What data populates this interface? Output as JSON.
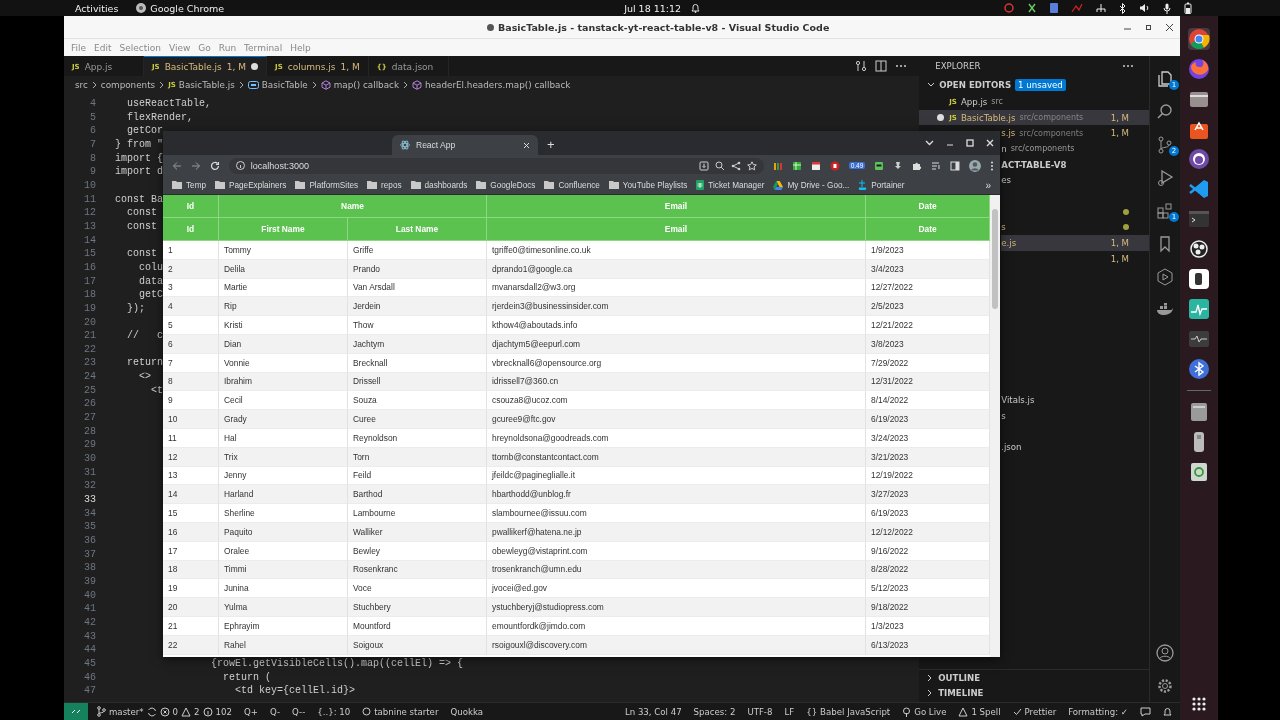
{
  "top_bar": {
    "activities": "Activities",
    "app": "Google Chrome",
    "clock": "Jul 18  11:12"
  },
  "vscode": {
    "title": "BasicTable.js - tanstack-yt-react-table-v8 - Visual Studio Code",
    "title_unsaved": true,
    "menu": [
      "File",
      "Edit",
      "Selection",
      "View",
      "Go",
      "Run",
      "Terminal",
      "Help"
    ],
    "tabs": [
      {
        "icon": "JS",
        "label": "App.js",
        "selected": false,
        "git_modified": false,
        "unsaved": false
      },
      {
        "icon": "JS",
        "label": "BasicTable.js",
        "status": "1, M",
        "selected": true,
        "git_modified": true,
        "unsaved": true
      },
      {
        "icon": "JS",
        "label": "columns.js",
        "status": "1, M",
        "selected": false,
        "git_modified": true,
        "unsaved": false
      },
      {
        "icon": "{}",
        "label": "data.json",
        "selected": false,
        "git_modified": false,
        "unsaved": false
      }
    ],
    "breadcrumbs": [
      {
        "kind": "folder",
        "label": "src"
      },
      {
        "kind": "folder",
        "label": "components"
      },
      {
        "kind": "file",
        "icon": "JS",
        "label": "BasicTable.js"
      },
      {
        "kind": "variable",
        "label": "BasicTable"
      },
      {
        "kind": "method",
        "label": "map() callback"
      },
      {
        "kind": "method",
        "label": "headerEl.headers.map() callback"
      }
    ],
    "code_lines": [
      {
        "number": "4",
        "text": "  useReactTable,",
        "current": false
      },
      {
        "number": "5",
        "text": "  flexRender,",
        "current": false
      },
      {
        "number": "6",
        "text": "  getCor",
        "current": false
      },
      {
        "number": "7",
        "text": "} from \"",
        "current": false
      },
      {
        "number": "8",
        "text": "import {",
        "current": false
      },
      {
        "number": "9",
        "text": "import d",
        "current": false
      },
      {
        "number": "10",
        "current": false
      },
      {
        "number": "11",
        "text": "const Ba",
        "current": false
      },
      {
        "number": "12",
        "text": "  const",
        "current": false
      },
      {
        "number": "13",
        "text": "  const",
        "current": false
      },
      {
        "number": "14",
        "current": false
      },
      {
        "number": "15",
        "text": "  const",
        "current": false
      },
      {
        "number": "16",
        "text": "    colu",
        "current": false
      },
      {
        "number": "17",
        "text": "    data",
        "current": false
      },
      {
        "number": "18",
        "text": "    getC",
        "current": false
      },
      {
        "number": "19",
        "text": "  });",
        "current": false
      },
      {
        "number": "20",
        "current": false
      },
      {
        "number": "21",
        "text": "  //   c",
        "current": false
      },
      {
        "number": "22",
        "current": false
      },
      {
        "number": "23",
        "text": "  return",
        "current": false
      },
      {
        "number": "24",
        "text": "    <>",
        "current": false
      },
      {
        "number": "25",
        "text": "      <t",
        "current": false
      },
      {
        "number": "26",
        "current": false
      },
      {
        "number": "27",
        "current": false
      },
      {
        "number": "28",
        "current": false
      },
      {
        "number": "29",
        "current": false
      },
      {
        "number": "30",
        "current": false
      },
      {
        "number": "31",
        "current": false
      },
      {
        "number": "32",
        "current": false
      },
      {
        "number": "33",
        "current": true
      },
      {
        "number": "34",
        "current": false
      },
      {
        "number": "35",
        "current": false
      },
      {
        "number": "36",
        "current": false
      },
      {
        "number": "37",
        "current": false
      },
      {
        "number": "38",
        "current": false
      },
      {
        "number": "39",
        "current": false
      },
      {
        "number": "40",
        "current": false
      },
      {
        "number": "41",
        "current": false
      },
      {
        "number": "42",
        "current": false
      },
      {
        "number": "43",
        "current": false
      },
      {
        "number": "44",
        "current": false
      },
      {
        "number": "45",
        "text": "                {rowEl.getVisibleCells().map((cellEl) => {",
        "current": false
      },
      {
        "number": "46",
        "text": "                  return (",
        "current": false
      },
      {
        "number": "47",
        "text": "                    <td key={cellEl.id}>",
        "current": false
      }
    ],
    "explorer": {
      "title": "EXPLORER",
      "open_editors": "OPEN EDITORS",
      "unsaved_badge": "1 unsaved",
      "rows": [
        {
          "kind": "full",
          "icon": "JS",
          "name": "App.js",
          "path": "src",
          "selected": false,
          "git_modified": false,
          "unsaved": false
        },
        {
          "kind": "full",
          "icon": "JS",
          "name": "BasicTable.js",
          "path": "src/components",
          "status": "1, M",
          "selected": true,
          "git_modified": true,
          "unsaved": true
        },
        {
          "kind": "fragment",
          "name": "s.js",
          "path": "src/components",
          "status": "1, M",
          "selected": false,
          "git_modified": true,
          "dot": false
        },
        {
          "kind": "fragment",
          "name": "n",
          "path": "src/components",
          "selected": false,
          "git_modified": false,
          "dot": false
        },
        {
          "kind": "section",
          "name": "ACT-TABLE-V8"
        },
        {
          "kind": "fragment",
          "name": "es",
          "selected": false,
          "git_modified": false,
          "dot": false
        },
        {
          "kind": "fragment",
          "selected": false,
          "dot": true
        },
        {
          "kind": "fragment",
          "name": "s",
          "selected": false,
          "git_modified": true,
          "dot": true
        },
        {
          "kind": "fragment",
          "name": "e.js",
          "status": "1, M",
          "selected": true,
          "git_modified": true,
          "dot": false
        },
        {
          "kind": "fragment",
          "status": "1, M",
          "selected": false,
          "git_modified": true,
          "dot": false
        },
        {
          "kind": "fragment",
          "name": "Vitals.js",
          "selected": false,
          "git_modified": false,
          "dot": false
        },
        {
          "kind": "fragment",
          "name": "s",
          "selected": false,
          "git_modified": false,
          "dot": false
        },
        {
          "kind": "fragment",
          "name": ".json",
          "selected": false,
          "git_modified": false,
          "dot": false
        }
      ],
      "bottom_sections": [
        {
          "label": "OUTLINE",
          "expanded": false
        },
        {
          "label": "TIMELINE",
          "expanded": false
        }
      ]
    },
    "activity_badges": {
      "explorer": "1",
      "source_control": "2",
      "extensions": "1"
    },
    "status_bar": {
      "branch": "master*",
      "errors": "0",
      "warnings": "2",
      "infos": "102",
      "quick": [
        "Q+",
        "Q-",
        "Q--"
      ],
      "braces": "{..}: 10",
      "tabnine": "tabnine starter",
      "quokka": "Quokka",
      "position": "Ln 33, Col 47",
      "spaces": "Spaces: 2",
      "encoding": "UTF-8",
      "eol": "LF",
      "language_icon": "{}",
      "language": "Babel JavaScript",
      "go_live": "Go Live",
      "spell": "1 Spell",
      "prettier": "Prettier",
      "formatting": "Formatting: ✓"
    }
  },
  "browser": {
    "tabs": [
      {
        "title": "React App",
        "selected": true
      }
    ],
    "new_tab": "+",
    "url": "localhost:3000",
    "extension_badge": "0.49",
    "bookmarks": [
      {
        "kind": "folder",
        "label": "Temp"
      },
      {
        "kind": "folder",
        "label": "PageExplainers"
      },
      {
        "kind": "folder",
        "label": "PlatformSites"
      },
      {
        "kind": "folder",
        "label": "repos"
      },
      {
        "kind": "folder",
        "label": "dashboards"
      },
      {
        "kind": "folder",
        "label": "GoogleDocs"
      },
      {
        "kind": "folder",
        "label": "Confluence"
      },
      {
        "kind": "folder",
        "label": "YouTube Playlists"
      },
      {
        "kind": "sheet",
        "label": "Ticket Manager"
      },
      {
        "kind": "drive",
        "label": "My Drive - Goo..."
      },
      {
        "kind": "ship",
        "label": "Portainer"
      }
    ],
    "bookmarks_more": "»",
    "table": {
      "header_groups": [
        {
          "label": "Id",
          "columns": [
            "Id"
          ]
        },
        {
          "label": "Name",
          "columns": [
            "First Name",
            "Last Name"
          ]
        },
        {
          "label": "Email",
          "columns": [
            "Email"
          ]
        },
        {
          "label": "Date",
          "columns": [
            "Date"
          ]
        }
      ],
      "rows": [
        [
          "1",
          "Tommy",
          "Griffe",
          "tgriffe0@timesonline.co.uk",
          "1/9/2023"
        ],
        [
          "2",
          "Delila",
          "Prando",
          "dprando1@google.ca",
          "3/4/2023"
        ],
        [
          "3",
          "Martie",
          "Van Arsdall",
          "mvanarsdall2@w3.org",
          "12/27/2022"
        ],
        [
          "4",
          "Rip",
          "Jerdein",
          "rjerdein3@businessinsider.com",
          "2/5/2023"
        ],
        [
          "5",
          "Kristi",
          "Thow",
          "kthow4@aboutads.info",
          "12/21/2022"
        ],
        [
          "6",
          "Dian",
          "Jachtym",
          "djachtym5@eepurl.com",
          "3/8/2023"
        ],
        [
          "7",
          "Vonnie",
          "Brecknall",
          "vbrecknall6@opensource.org",
          "7/29/2022"
        ],
        [
          "8",
          "Ibrahim",
          "Drissell",
          "idrissell7@360.cn",
          "12/31/2022"
        ],
        [
          "9",
          "Cecil",
          "Souza",
          "csouza8@ucoz.com",
          "8/14/2022"
        ],
        [
          "10",
          "Grady",
          "Curee",
          "gcuree9@ftc.gov",
          "6/19/2023"
        ],
        [
          "11",
          "Hal",
          "Reynoldson",
          "hreynoldsona@goodreads.com",
          "3/24/2023"
        ],
        [
          "12",
          "Trix",
          "Torn",
          "ttornb@constantcontact.com",
          "3/21/2023"
        ],
        [
          "13",
          "Jenny",
          "Feild",
          "jfeildc@pagineglialle.it",
          "12/19/2022"
        ],
        [
          "14",
          "Harland",
          "Barthod",
          "hbarthodd@unblog.fr",
          "3/27/2023"
        ],
        [
          "15",
          "Sherline",
          "Lambourne",
          "slambournee@issuu.com",
          "6/19/2023"
        ],
        [
          "16",
          "Paquito",
          "Walliker",
          "pwallikerf@hatena.ne.jp",
          "12/12/2022"
        ],
        [
          "17",
          "Oralee",
          "Bewley",
          "obewleyg@vistaprint.com",
          "9/16/2022"
        ],
        [
          "18",
          "Timmi",
          "Rosenkranc",
          "trosenkranch@umn.edu",
          "8/28/2022"
        ],
        [
          "19",
          "Junina",
          "Voce",
          "jvocei@ed.gov",
          "5/12/2023"
        ],
        [
          "20",
          "Yulma",
          "Stuchbery",
          "ystuchberyj@studiopress.com",
          "9/18/2022"
        ],
        [
          "21",
          "Ephrayim",
          "Mountford",
          "emountfordk@jimdo.com",
          "1/3/2023"
        ],
        [
          "22",
          "Rahel",
          "Soigoux",
          "rsoigouxl@discovery.com",
          "6/13/2023"
        ]
      ]
    }
  }
}
